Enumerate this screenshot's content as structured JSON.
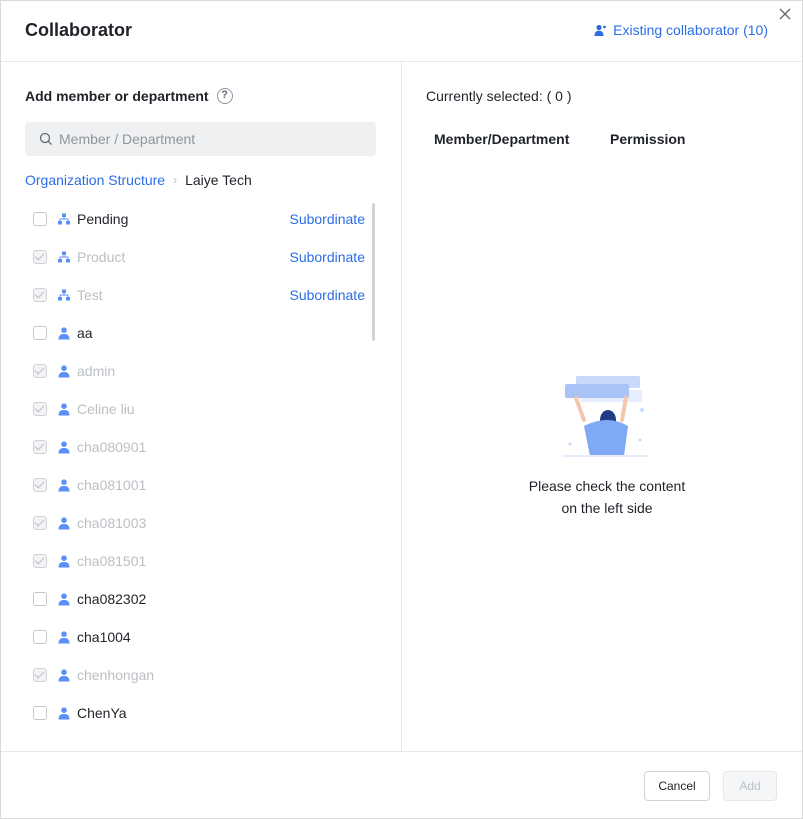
{
  "dialog": {
    "title": "Collaborator",
    "existing_collaborator": "Existing collaborator (10)"
  },
  "left": {
    "section_title": "Add member or department",
    "search_placeholder": "Member / Department",
    "breadcrumb": {
      "root": "Organization Structure",
      "separator": "›",
      "current": "Laiye Tech"
    },
    "items": [
      {
        "label": "Pending",
        "type": "department",
        "checked": false,
        "disabled": false,
        "action": "Subordinate"
      },
      {
        "label": "Product",
        "type": "department",
        "checked": true,
        "disabled": true,
        "action": "Subordinate"
      },
      {
        "label": "Test",
        "type": "department",
        "checked": true,
        "disabled": true,
        "action": "Subordinate"
      },
      {
        "label": "aa",
        "type": "member",
        "checked": false,
        "disabled": false
      },
      {
        "label": "admin",
        "type": "member",
        "checked": true,
        "disabled": true
      },
      {
        "label": "Celine liu",
        "type": "member",
        "checked": true,
        "disabled": true
      },
      {
        "label": "cha080901",
        "type": "member",
        "checked": true,
        "disabled": true
      },
      {
        "label": "cha081001",
        "type": "member",
        "checked": true,
        "disabled": true
      },
      {
        "label": "cha081003",
        "type": "member",
        "checked": true,
        "disabled": true
      },
      {
        "label": "cha081501",
        "type": "member",
        "checked": true,
        "disabled": true
      },
      {
        "label": "cha082302",
        "type": "member",
        "checked": false,
        "disabled": false
      },
      {
        "label": "cha1004",
        "type": "member",
        "checked": false,
        "disabled": false
      },
      {
        "label": "chenhongan",
        "type": "member",
        "checked": true,
        "disabled": true
      },
      {
        "label": "ChenYa",
        "type": "member",
        "checked": false,
        "disabled": false
      }
    ]
  },
  "right": {
    "selected_label": "Currently selected: ( 0 )",
    "col_member": "Member/Department",
    "col_permission": "Permission",
    "empty_line1": "Please check the content",
    "empty_line2": "on the left side"
  },
  "footer": {
    "cancel": "Cancel",
    "add": "Add"
  },
  "colors": {
    "accent": "#2b6de5",
    "icon_blue": "#5b8ff9",
    "disabled_text": "#bbbfc4"
  }
}
